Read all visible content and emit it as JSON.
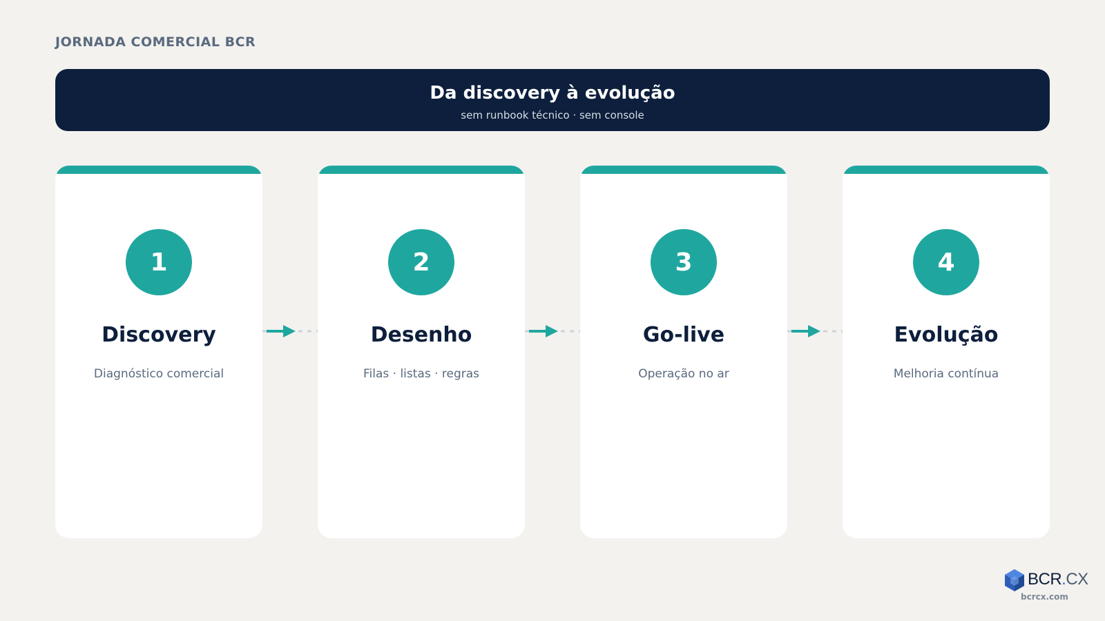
{
  "header": {
    "eyebrow": "JORNADA COMERCIAL BCR",
    "title": "Da discovery à evolução",
    "subtitle": "sem runbook técnico · sem console"
  },
  "steps": [
    {
      "number": "1",
      "title": "Discovery",
      "description": "Diagnóstico comercial"
    },
    {
      "number": "2",
      "title": "Desenho",
      "description": "Filas · listas · regras"
    },
    {
      "number": "3",
      "title": "Go-live",
      "description": "Operação no ar"
    },
    {
      "number": "4",
      "title": "Evolução",
      "description": "Melhoria contínua"
    }
  ],
  "connectors": [
    {
      "icon": "arrow-right-icon"
    },
    {
      "icon": "arrow-right-icon"
    },
    {
      "icon": "arrow-right-icon"
    }
  ],
  "logo": {
    "brand": "BCR",
    "dot": ".",
    "suffix": "CX",
    "icon": "cube-logo-icon",
    "domain": "bcrcx.com"
  },
  "colors": {
    "background": "#f3f2ef",
    "navy": "#0d1f3c",
    "teal": "#1fa79f",
    "muted": "#5a6a7e",
    "brand_blue": "#2d6bd1"
  }
}
